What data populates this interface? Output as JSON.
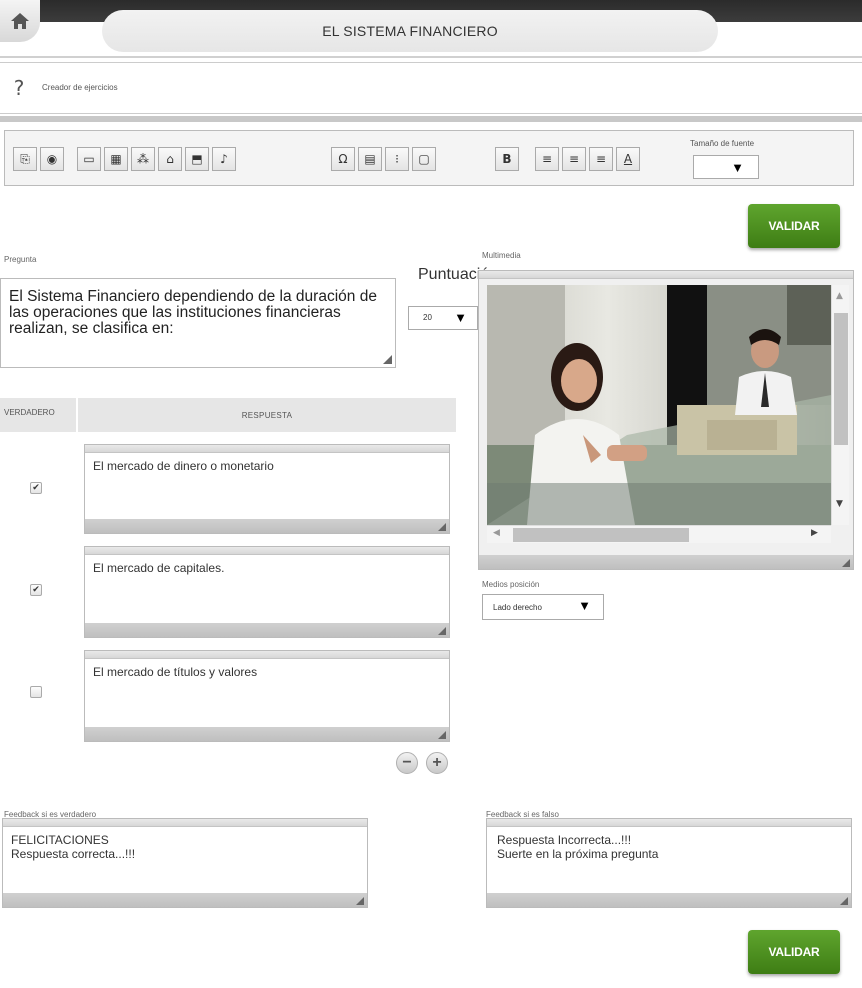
{
  "header": {
    "title": "EL SISTEMA FINANCIERO",
    "home_icon": "home-icon"
  },
  "help": {
    "label": "Creador de ejercicios",
    "icon": "help-icon"
  },
  "toolbar": {
    "buttons": [
      "paste-icon",
      "globe-icon",
      "image-icon",
      "gallery-icon",
      "network-icon",
      "sound-bag-icon",
      "video-icon",
      "music-note-icon",
      "omega-icon",
      "table-icon",
      "list-icon",
      "page-icon",
      "bold-icon",
      "align-left-icon",
      "align-center-icon",
      "align-right-icon",
      "text-color-icon"
    ],
    "glyphs": [
      "⎘",
      "◉",
      "▭",
      "▦",
      "⁂",
      "⌂",
      "⬒",
      "♪",
      "Ω",
      "▤",
      "⁝",
      "▢",
      "B",
      "≡",
      "≡",
      "≡",
      "A"
    ],
    "font_size_label": "Tamaño de fuente",
    "font_size_value": ""
  },
  "validar_label": "VALIDAR",
  "question": {
    "label": "Pregunta",
    "text": "El Sistema Financiero dependiendo de la duración de las operaciones que las instituciones financieras realizan, se clasifica en:"
  },
  "score": {
    "label": "Puntuación",
    "value": "20"
  },
  "answers": {
    "col_true": "VERDADERO",
    "col_answer": "RESPUESTA",
    "items": [
      {
        "text": "El mercado de dinero o monetario",
        "checked": "✔"
      },
      {
        "text": "El mercado de capitales.",
        "checked": "✔"
      },
      {
        "text": "El mercado de títulos y valores",
        "checked": ""
      }
    ],
    "remove_label": "−",
    "add_label": "+"
  },
  "multimedia": {
    "label": "Multimedia",
    "image": "bank-teller-photo"
  },
  "media_position": {
    "label": "Medios posición",
    "value": "Lado derecho"
  },
  "feedback_true": {
    "label": "Feedback si es verdadero",
    "text": "FELICITACIONES\nRespuesta correcta...!!!"
  },
  "feedback_false": {
    "label": "Feedback si es falso",
    "text": "Respuesta Incorrecta...!!!\nSuerte en la próxima pregunta"
  },
  "colors": {
    "accent_green": "#4a8f1f",
    "border_gray": "#bbbbbb"
  }
}
